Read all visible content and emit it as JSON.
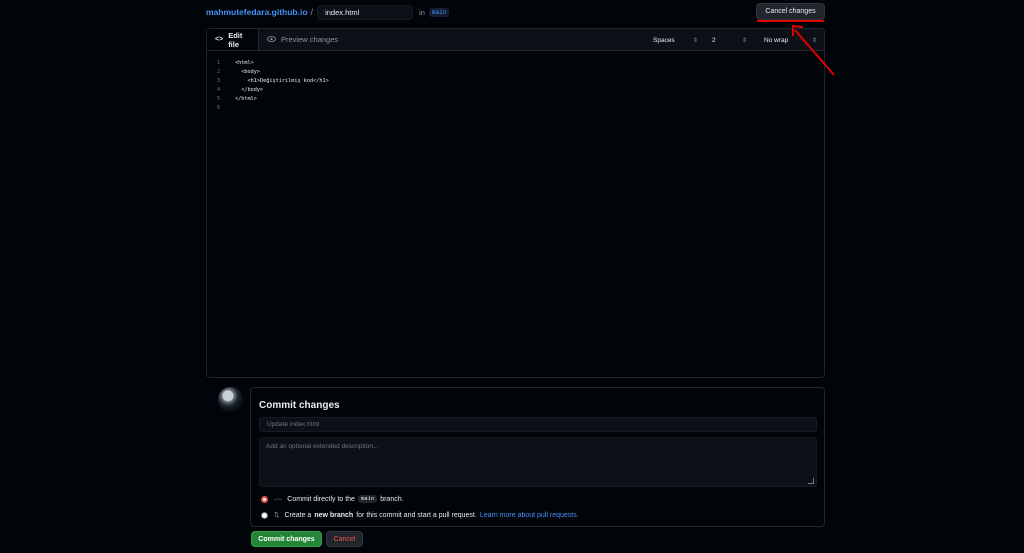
{
  "header": {
    "repo_name": "mahmutefedara.github.io",
    "separator": "/",
    "filename": "index.html",
    "in_label": "in",
    "branch": "main",
    "cancel_changes_label": "Cancel changes"
  },
  "editor": {
    "tabs": [
      {
        "label": "Edit file",
        "icon": "code-icon",
        "active": true
      },
      {
        "label": "Preview changes",
        "icon": "eye-icon",
        "active": false
      }
    ],
    "indent_mode": "Spaces",
    "indent_size": "2",
    "wrap_mode": "No wrap",
    "lines": [
      {
        "n": "1",
        "text": "<html>"
      },
      {
        "n": "2",
        "text": "  <body>"
      },
      {
        "n": "3",
        "text": "    <h1>Değiştirilmiş kod</h1>"
      },
      {
        "n": "4",
        "text": "  </body>"
      },
      {
        "n": "5",
        "text": "</html>"
      },
      {
        "n": "6",
        "text": ""
      }
    ]
  },
  "commit": {
    "title": "Commit changes",
    "summary_placeholder": "Update index.html",
    "description_placeholder": "Add an optional extended description...",
    "option_direct": {
      "prefix": "Commit directly to the",
      "branch": "main",
      "suffix": "branch."
    },
    "option_new_branch": {
      "prefix": "Create a",
      "bold": "new branch",
      "suffix": "for this commit and start a pull request.",
      "link": "Learn more about pull requests."
    },
    "commit_button": "Commit changes",
    "cancel_button": "Cancel"
  },
  "colors": {
    "background": "#010409",
    "accent_link": "#4493f8",
    "commit_green": "#238636",
    "cancel_red": "#f85149",
    "annotation_red": "#e00000"
  }
}
